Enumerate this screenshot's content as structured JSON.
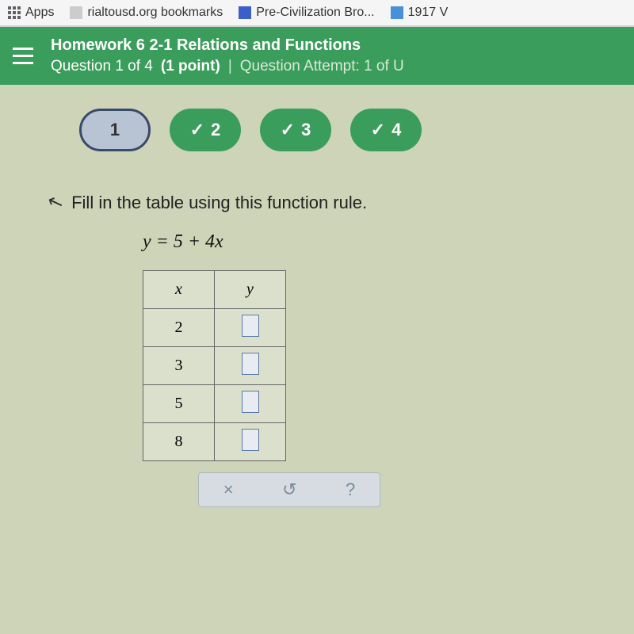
{
  "bookmarks": {
    "apps": "Apps",
    "items": [
      "rialtousd.org bookmarks",
      "Pre-Civilization Bro...",
      "1917 V"
    ]
  },
  "header": {
    "hw_title": "Homework 6 2-1 Relations and Functions",
    "question_of": "Question 1 of 4",
    "points": "(1 point)",
    "attempt": "Question Attempt: 1 of U"
  },
  "pills": {
    "p1": "1",
    "p2": "2",
    "p3": "3",
    "p4": "4"
  },
  "content": {
    "prompt": "Fill in the table using this function rule.",
    "equation": "y = 5 + 4x"
  },
  "table": {
    "x_header": "x",
    "y_header": "y",
    "rows": [
      {
        "x": "2"
      },
      {
        "x": "3"
      },
      {
        "x": "5"
      },
      {
        "x": "8"
      }
    ]
  },
  "toolbar": {
    "clear": "×",
    "undo": "↺",
    "help": "?"
  }
}
